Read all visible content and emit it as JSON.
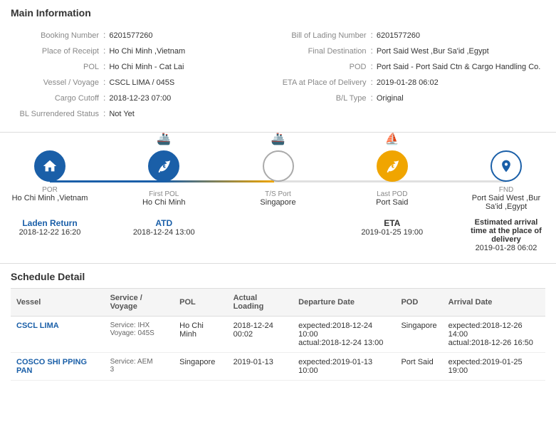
{
  "mainInfo": {
    "title": "Main Information",
    "fields": {
      "bookingNumber": {
        "label": "Booking Number",
        "value": "6201577260"
      },
      "billOfLading": {
        "label": "Bill of Lading Number",
        "value": "6201577260"
      },
      "placeOfReceipt": {
        "label": "Place of Receipt",
        "value": "Ho Chi Minh ,Vietnam"
      },
      "finalDestination": {
        "label": "Final Destination",
        "value": "Port Said West ,Bur Sa'id ,Egypt"
      },
      "pol": {
        "label": "POL",
        "value": "Ho Chi Minh - Cat Lai"
      },
      "pod": {
        "label": "POD",
        "value": "Port Said - Port Said Ctn & Cargo Handling Co."
      },
      "vessel": {
        "label": "Vessel / Voyage",
        "value": "CSCL LIMA / 045S"
      },
      "eta": {
        "label": "ETA at Place of Delivery",
        "value": "2019-01-28 06:02"
      },
      "cargoCutoff": {
        "label": "Cargo Cutoff",
        "value": "2018-12-23 07:00"
      },
      "blType": {
        "label": "B/L Type",
        "value": "Original"
      },
      "blSurrendered": {
        "label": "BL Surrendered Status",
        "value": "Not Yet"
      }
    }
  },
  "tracking": {
    "nodes": [
      {
        "id": "por",
        "type": "POR",
        "name": "Ho Chi Minh ,Vietnam",
        "icon": "🏠",
        "style": "filled"
      },
      {
        "id": "first-pol",
        "type": "First POL",
        "name": "Ho Chi Minh",
        "icon": "⚓",
        "style": "filled"
      },
      {
        "id": "ts-port",
        "type": "T/S Port",
        "name": "Singapore",
        "icon": "📦",
        "style": "empty"
      },
      {
        "id": "last-pod",
        "type": "Last POD",
        "name": "Port Said",
        "icon": "⚓",
        "style": "gold"
      },
      {
        "id": "fnd",
        "type": "FND",
        "name": "Port Said West ,Bur Sa'id ,Egypt",
        "icon": "📍",
        "style": "outline-blue"
      }
    ],
    "times": [
      {
        "id": "laden-return",
        "label": "Laden Return",
        "value": "2018-12-22 16:20",
        "color": "blue"
      },
      {
        "id": "atd",
        "label": "ATD",
        "value": "2018-12-24 13:00",
        "color": "blue"
      },
      {
        "id": "eta-time",
        "label": "ETA",
        "value": "2019-01-25 19:00",
        "color": "dark"
      },
      {
        "id": "est-arrival",
        "label": "Estimated arrival time at the place of delivery",
        "value": "2019-01-28 06:02",
        "color": "dark"
      }
    ]
  },
  "schedule": {
    "title": "Schedule Detail",
    "columns": [
      "Vessel",
      "Service / Voyage",
      "POL",
      "Actual Loading",
      "Departure Date",
      "POD",
      "Arrival Date"
    ],
    "rows": [
      {
        "vessel": "CSCL LIMA",
        "service": "Service: IHX",
        "voyage": "Voyage: 045S",
        "pol": "Ho Chi Minh",
        "actualLoading": "2018-12-24 00:02",
        "departureDate": "expected: 2018-12-24 10:00\nactual: 2018-12-24 13:00",
        "pod": "Singapore",
        "arrivalDate": "expected: 2018-12-26 14:00\nactual: 2018-12-26 16:50"
      },
      {
        "vessel": "COSCO SHI PPING PAN",
        "service": "Service: AEM",
        "voyage": "3",
        "pol": "Singapore",
        "actualLoading": "2019-01-13",
        "departureDate": "expected: 2019-01-13 10:00",
        "pod": "Port Said",
        "arrivalDate": "expected: 2019-01-25 19:00"
      }
    ]
  }
}
